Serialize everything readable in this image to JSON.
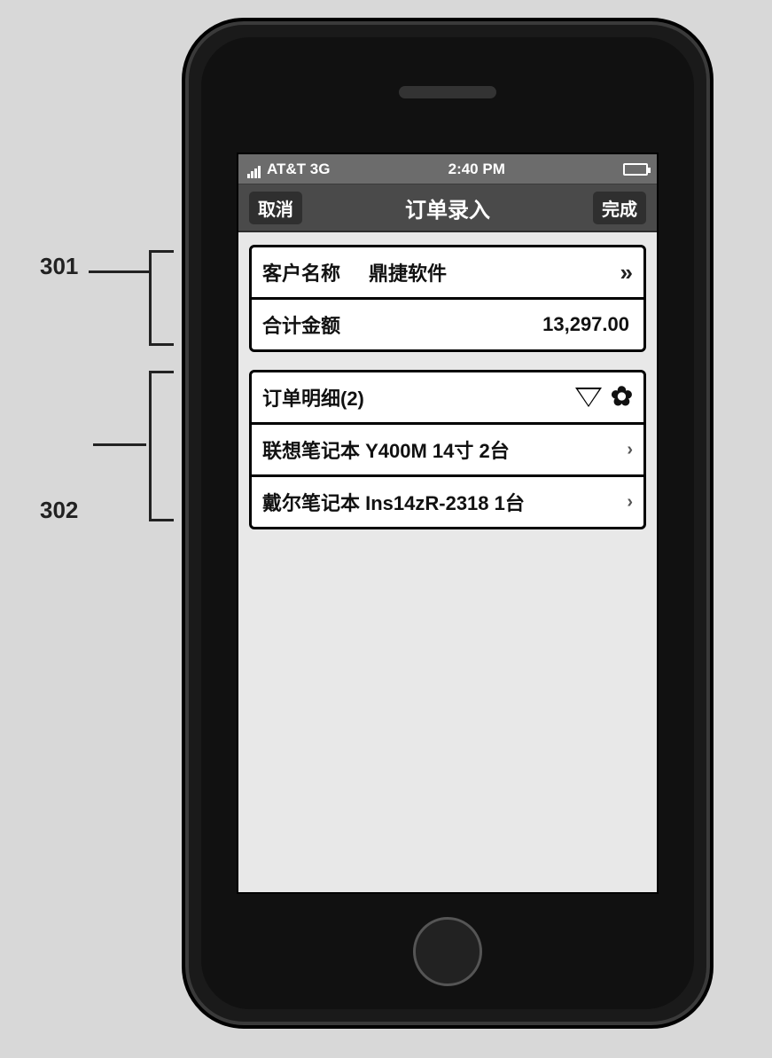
{
  "callouts": {
    "a": "301",
    "b": "302"
  },
  "statusbar": {
    "carrier": "AT&T  3G",
    "time": "2:40 PM"
  },
  "navbar": {
    "back": "取消",
    "title": "订单录入",
    "done": "完成"
  },
  "header": {
    "customer_label": "客户名称",
    "customer_value": "鼎捷软件",
    "total_label": "合计金额",
    "total_value": "13,297.00"
  },
  "details": {
    "title": "订单明细(2)",
    "items": [
      "联想笔记本 Y400M 14寸 2台",
      "戴尔笔记本 Ins14zR-2318 1台"
    ]
  }
}
